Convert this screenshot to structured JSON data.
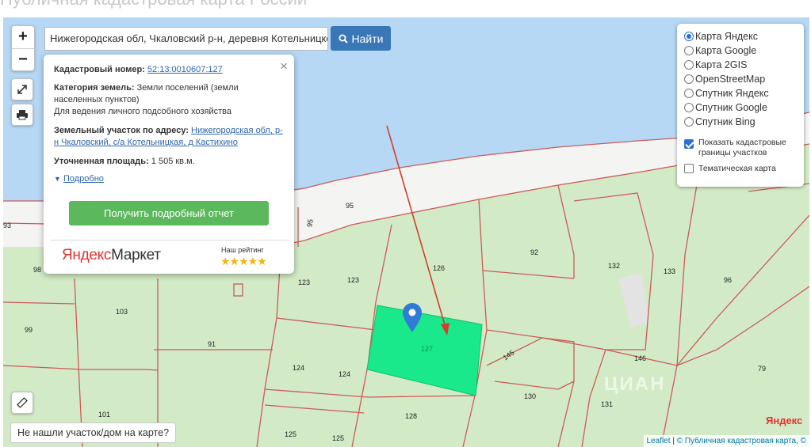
{
  "page_title": "Публичная кадастровая карта России",
  "search": {
    "value": "Нижегородская обл, Чкаловский р-н, деревня Котельницкое",
    "button_label": "Найти"
  },
  "zoom": {
    "in_label": "+",
    "out_label": "−"
  },
  "popup": {
    "cadastral_label": "Кадастровый номер:",
    "cadastral_value": "52:13:0010607:127",
    "category_label": "Категория земель:",
    "category_value": "Земли поселений (земли населенных пунктов)",
    "use_value": "Для ведения личного подсобного хозяйства",
    "address_label": "Земельный участок по адресу:",
    "address_value": "Нижегородская обл, р-н Чкаловский, с/а Котельницкая, д Кастихино",
    "area_label": "Уточненная площадь:",
    "area_value": "1 505 кв.м.",
    "details_link": "Подробно",
    "report_button": "Получить подробный отчет",
    "ad_logo_part1": "Яндекс",
    "ad_logo_part2": "Маркет",
    "rating_label": "Наш рейтинг",
    "stars": "★★★★★"
  },
  "layers": {
    "base_maps": [
      {
        "label": "Карта Яндекс",
        "selected": true
      },
      {
        "label": "Карта Google",
        "selected": false
      },
      {
        "label": "Карта 2GIS",
        "selected": false
      },
      {
        "label": "OpenStreetMap",
        "selected": false
      },
      {
        "label": "Спутник Яндекс",
        "selected": false
      },
      {
        "label": "Спутник Google",
        "selected": false
      },
      {
        "label": "Спутник Bing",
        "selected": false
      }
    ],
    "show_boundaries": "Показать кадастровые границы участков",
    "show_boundaries_checked": true,
    "thematic": "Тематическая карта",
    "thematic_checked": false
  },
  "not_found_button": "Не нашли участок/дом на карте?",
  "attribution": {
    "leaflet": "Leaflet",
    "separator": "|",
    "source": "© Публичная кадастровая карта, ©"
  },
  "map_labels": {
    "parcel_numbers": [
      "93",
      "95",
      "95",
      "98",
      "99",
      "103",
      "91",
      "101",
      "123",
      "123",
      "126",
      "92",
      "132",
      "133",
      "96",
      "124",
      "124",
      "127",
      "145",
      "146",
      "79",
      "130",
      "131",
      "128",
      "125",
      "125"
    ],
    "yandex_logo": "Яндекс",
    "watermark": "ЦИАН"
  },
  "colors": {
    "water": "#b6d8f5",
    "land": "#d2ebc6",
    "parcel_border": "#cc5a5a",
    "selected_parcel": "#19e98a",
    "marker": "#2f7bd6",
    "arrow": "#d23e2e",
    "button_blue": "#3a77b6",
    "button_green": "#5cb85c"
  }
}
